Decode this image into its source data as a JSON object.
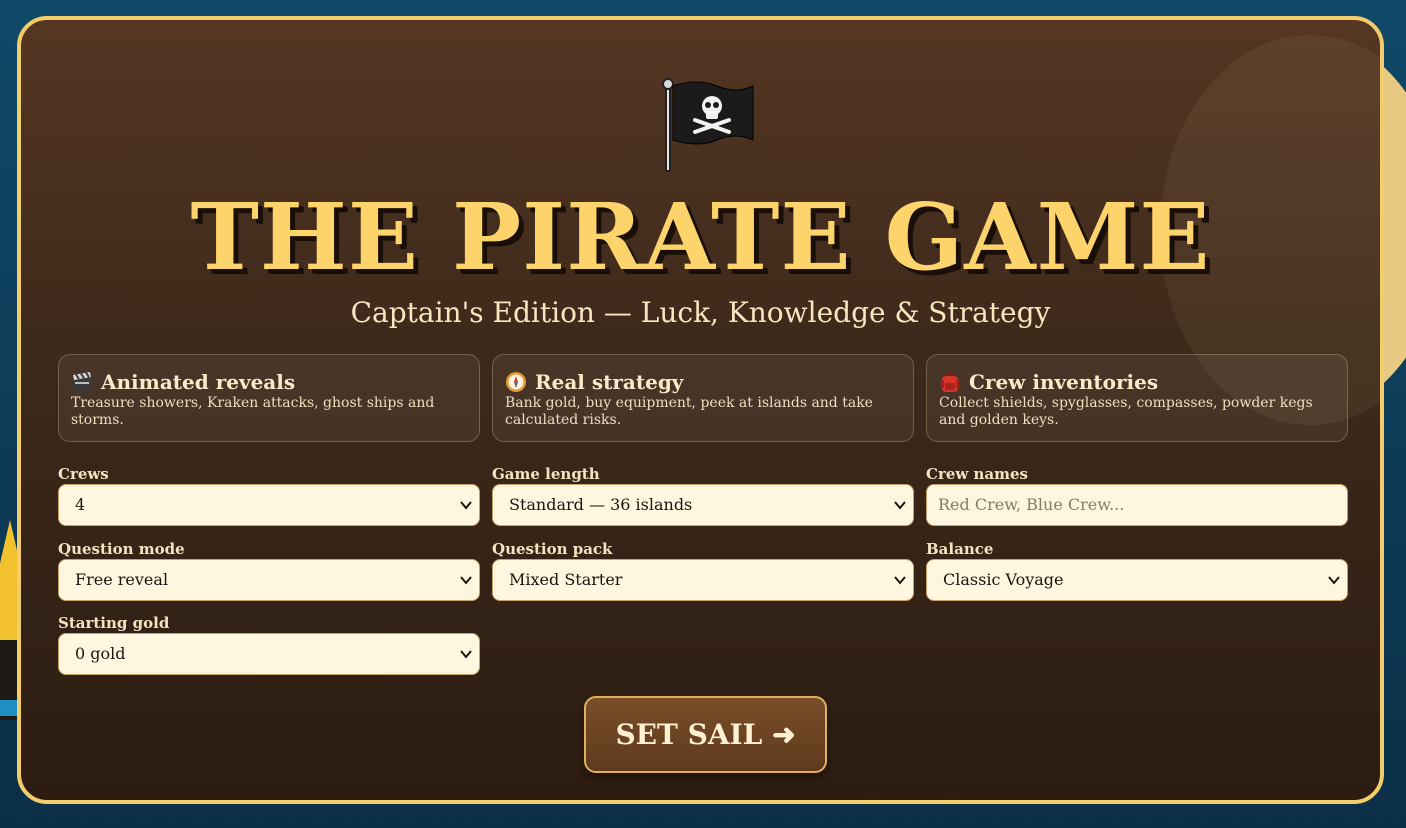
{
  "header": {
    "title": "THE PIRATE GAME",
    "subtitle": "Captain's Edition — Luck, Knowledge & Strategy"
  },
  "features": [
    {
      "icon": "clapperboard-icon",
      "title": "Animated reveals",
      "description": "Treasure showers, Kraken attacks, ghost ships and storms."
    },
    {
      "icon": "compass-icon",
      "title": "Real strategy",
      "description": "Bank gold, buy equipment, peek at islands and take calculated risks."
    },
    {
      "icon": "backpack-icon",
      "title": "Crew inventories",
      "description": "Collect shields, spyglasses, compasses, powder kegs and golden keys."
    }
  ],
  "settings": {
    "crews": {
      "label": "Crews",
      "value": "4"
    },
    "game_length": {
      "label": "Game length",
      "value": "Standard — 36 islands"
    },
    "crew_names": {
      "label": "Crew names",
      "placeholder": "Red Crew, Blue Crew..."
    },
    "question_mode": {
      "label": "Question mode",
      "value": "Free reveal"
    },
    "question_pack": {
      "label": "Question pack",
      "value": "Mixed Starter"
    },
    "balance": {
      "label": "Balance",
      "value": "Classic Voyage"
    },
    "starting_gold": {
      "label": "Starting gold",
      "value": "0 gold"
    }
  },
  "actions": {
    "start_label": "SET SAIL ➜"
  },
  "colors": {
    "title_gold": "#fdd36c",
    "panel_border": "#f3cd6b",
    "panel_bg": "#3e2a1b",
    "sea_blue": "#0f4a68"
  }
}
